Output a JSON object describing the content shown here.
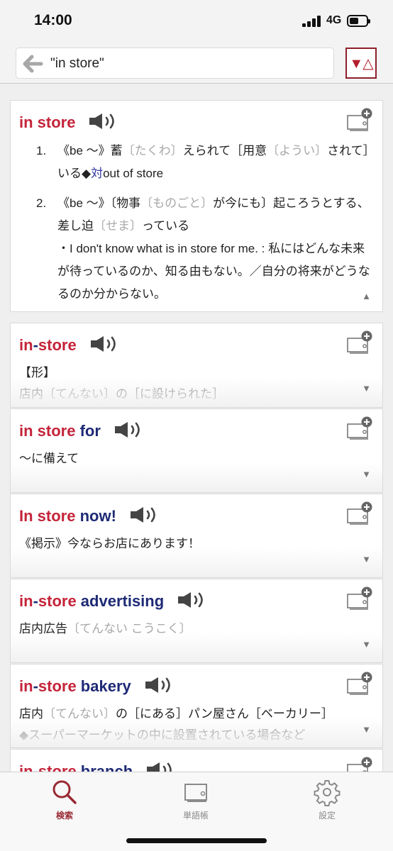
{
  "status": {
    "time": "14:00",
    "network": "4G"
  },
  "search": {
    "query": "\"in store\"",
    "sort_label": "▼△"
  },
  "entries": [
    {
      "headword": [
        {
          "t": "in store",
          "c": "r"
        }
      ],
      "senses": [
        {
          "num": "1.",
          "parts": [
            {
              "t": "《be 〜》蓄"
            },
            {
              "t": "〔たくわ〕",
              "c": "gray"
            },
            {
              "t": "えられて［用意"
            },
            {
              "t": "〔ようい〕",
              "c": "gray"
            },
            {
              "t": "されて］いる◆"
            },
            {
              "t": "対",
              "c": "hl"
            },
            {
              "t": "out of store"
            }
          ]
        },
        {
          "num": "2.",
          "parts": [
            {
              "t": "《be 〜》〔物事"
            },
            {
              "t": "〔ものごと〕",
              "c": "gray"
            },
            {
              "t": "が今にも〕起ころうとする、差し迫"
            },
            {
              "t": "〔せま〕",
              "c": "gray"
            },
            {
              "t": "っている"
            },
            {
              "br": true
            },
            {
              "t": "・I don't know what is in store for me. : 私にはどんな未来が待っているのか、知る由もない。／自分の将来がどうなるのか分からない。"
            }
          ]
        }
      ],
      "caret": "▲"
    },
    {
      "headword": [
        {
          "t": "in",
          "c": "r"
        },
        {
          "t": "-",
          "c": "n"
        },
        {
          "t": "store",
          "c": "r"
        }
      ],
      "lines": [
        [
          {
            "t": "【形】",
            "c": "blue"
          }
        ],
        [
          {
            "t": "店内",
            "c": "fade"
          },
          {
            "t": "〔てんない〕",
            "c": "gray"
          },
          {
            "t": "の［に設けられた］",
            "c": "fade"
          }
        ]
      ],
      "caret": "▼"
    },
    {
      "headword": [
        {
          "t": "in store",
          "c": "r"
        },
        {
          "t": " for",
          "c": "n"
        }
      ],
      "lines": [
        [
          {
            "t": "〜に備えて"
          }
        ]
      ],
      "caret": "▼"
    },
    {
      "headword": [
        {
          "t": "In store",
          "c": "r"
        },
        {
          "t": " now!",
          "c": "n"
        }
      ],
      "lines": [
        [
          {
            "t": "《掲示》今ならお店にあります！"
          }
        ]
      ],
      "caret": "▼"
    },
    {
      "headword": [
        {
          "t": "in",
          "c": "r"
        },
        {
          "t": "-",
          "c": "n"
        },
        {
          "t": "store",
          "c": "r"
        },
        {
          "t": " advertising",
          "c": "n"
        }
      ],
      "lines": [
        [
          {
            "t": "店内広告"
          },
          {
            "t": "〔てんない こうこく〕",
            "c": "gray"
          }
        ]
      ],
      "caret": "▼"
    },
    {
      "headword": [
        {
          "t": "in",
          "c": "r"
        },
        {
          "t": "-",
          "c": "n"
        },
        {
          "t": "store",
          "c": "r"
        },
        {
          "t": " bakery",
          "c": "n"
        }
      ],
      "lines": [
        [
          {
            "t": "店内"
          },
          {
            "t": "〔てんない〕",
            "c": "gray"
          },
          {
            "t": "の［にある］パン屋さん［ベーカリー］"
          }
        ],
        [
          {
            "t": "◆スーパーマーケットの中に設置されている場合など",
            "c": "fade"
          }
        ]
      ],
      "caret": "▼"
    },
    {
      "headword": [
        {
          "t": "in",
          "c": "r"
        },
        {
          "t": "-",
          "c": "n"
        },
        {
          "t": "store",
          "c": "r"
        },
        {
          "t": " branch",
          "c": "n"
        }
      ],
      "lines": [],
      "caret": ""
    }
  ],
  "tabs": [
    {
      "label": "検索",
      "icon": "magnifier-icon",
      "active": true
    },
    {
      "label": "単語帳",
      "icon": "wordbook-icon",
      "active": false
    },
    {
      "label": "設定",
      "icon": "gear-icon",
      "active": false
    }
  ],
  "colors": {
    "accent": "#9a2a33",
    "headword_red": "#c4243a",
    "headword_navy": "#1e2a75"
  }
}
